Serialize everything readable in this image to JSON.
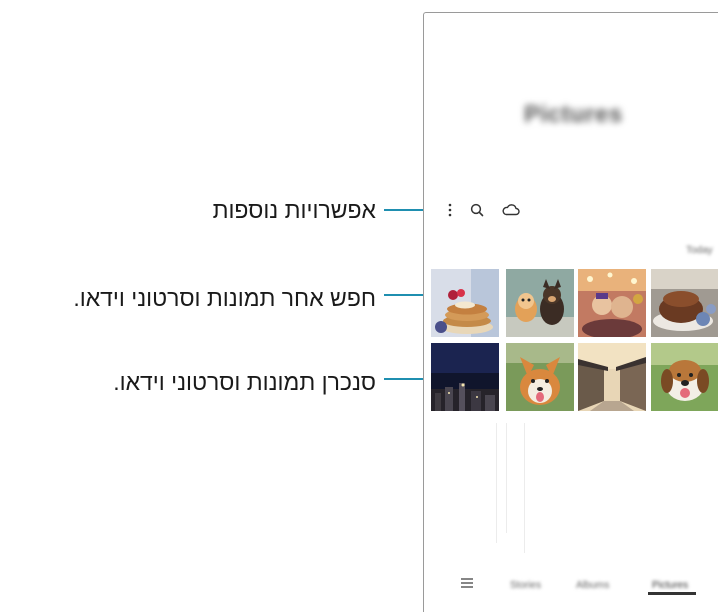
{
  "callouts": {
    "more_options": "אפשרויות נוספות",
    "search": "חפש אחר תמונות וסרטוני וידאו.",
    "sync": "סנכרן תמונות וסרטוני וידאו."
  },
  "app": {
    "title": "Pictures",
    "section_label": "Today",
    "toolbar": {
      "more_icon": "more-options-icon",
      "search_icon": "search-icon",
      "cloud_icon": "cloud-icon"
    },
    "thumbnails": [
      {
        "name": "pancakes-photo"
      },
      {
        "name": "dogs-photo"
      },
      {
        "name": "party-photo"
      },
      {
        "name": "cake-photo"
      },
      {
        "name": "city-night-photo"
      },
      {
        "name": "corgi-photo"
      },
      {
        "name": "street-photo"
      },
      {
        "name": "beagle-photo"
      }
    ],
    "bottom_nav": {
      "menu_icon": "menu-icon",
      "tabs": [
        "Stories",
        "Albums",
        "Pictures"
      ],
      "active_tab": "Pictures"
    }
  },
  "colors": {
    "callout_line": "#1f8fb0",
    "active_tab_underline": "#333333"
  }
}
